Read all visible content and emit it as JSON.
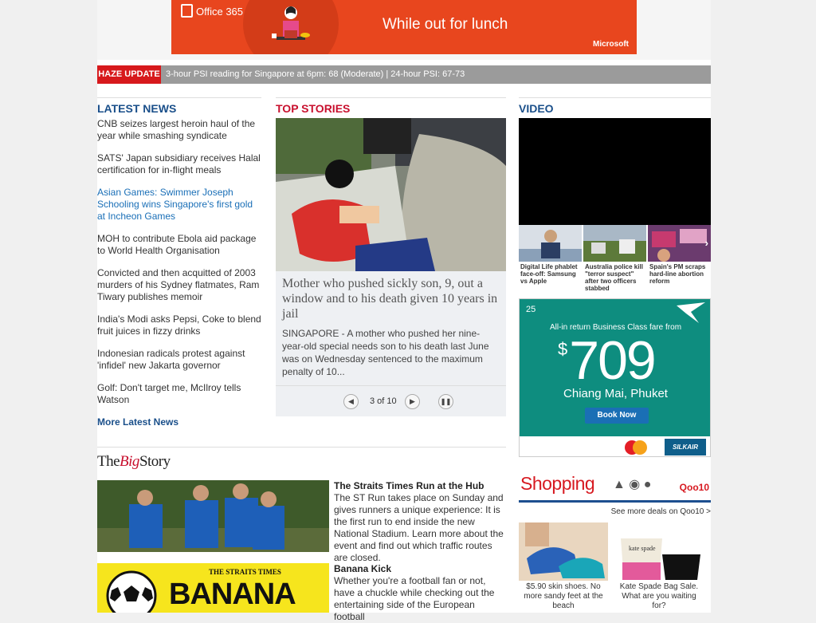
{
  "ad": {
    "brand": "Office 365",
    "tagline": "While out for lunch",
    "sponsor": "Microsoft"
  },
  "haze": {
    "label": "HAZE UPDATE",
    "text": "3-hour PSI reading for Singapore at 6pm: 68 (Moderate) | 24-hour PSI: 67-73"
  },
  "latest": {
    "title": "LATEST NEWS",
    "items": [
      "CNB seizes largest heroin haul of the year while smashing syndicate",
      "SATS' Japan subsidiary receives Halal certification for in-flight meals",
      "Asian Games: Swimmer Joseph Schooling wins Singapore's first gold at Incheon Games",
      "MOH to contribute Ebola aid package to World Health Organisation",
      "Convicted and then acquitted of 2003 murders of his Sydney flatmates, Ram Tiwary publishes memoir",
      "India's Modi asks Pepsi, Coke to blend fruit juices in fizzy drinks",
      "Indonesian radicals protest against 'infidel' new Jakarta governor",
      "Golf: Don't target me, McIlroy tells Watson"
    ],
    "more": "More Latest News"
  },
  "top": {
    "title": "TOP STORIES",
    "headline": "Mother who pushed sickly son, 9, out a window and to his death given 10 years in jail",
    "summary": "SINGAPORE - A mother who pushed her nine-year-old special needs son to his death last June was on Wednesday sentenced to the maximum penalty of 10...",
    "counter": "3 of 10"
  },
  "video": {
    "title": "VIDEO",
    "thumbs": [
      "Digital Life phablet face-off: Samsung vs Apple",
      "Australia police kill \"terror suspect\" after two officers stabbed",
      "Spain's PM scraps hard-line abortion reform"
    ]
  },
  "silkair": {
    "anniv": "25",
    "allin": "All-in return Business Class fare from",
    "dollar": "$",
    "price": "709",
    "dest": "Chiang Mai, Phuket",
    "book": "Book Now",
    "brand": "SILKAIR"
  },
  "bigstory": {
    "title_the": "The",
    "title_big": "Big",
    "title_story": "Story",
    "items": [
      {
        "title": "The Straits Times Run at the Hub",
        "text": "The ST Run takes place on Sunday and gives runners a unique experience: It is the first run to end inside the new National Stadium. Learn more about the event and find out which traffic routes are closed."
      },
      {
        "title": "Banana Kick",
        "text": "Whether you're a football fan or not, have a chuckle while checking out the entertaining side of the European football"
      }
    ],
    "banner_small": "THE STRAITS TIMES",
    "banner_big": "BANANA KICK"
  },
  "shopping": {
    "logo": "Shopping",
    "brand": "Qoo10",
    "deals": "See more deals on Qoo10 >",
    "items": [
      "$5.90 skin shoes. No more sandy feet at the beach",
      "Kate Spade Bag Sale. What are you waiting for?"
    ]
  },
  "colors": {
    "accent_blue": "#1a4f8a",
    "accent_red": "#d7191c",
    "silkair_teal": "#0e8d7f",
    "office_orange": "#e8461e"
  }
}
